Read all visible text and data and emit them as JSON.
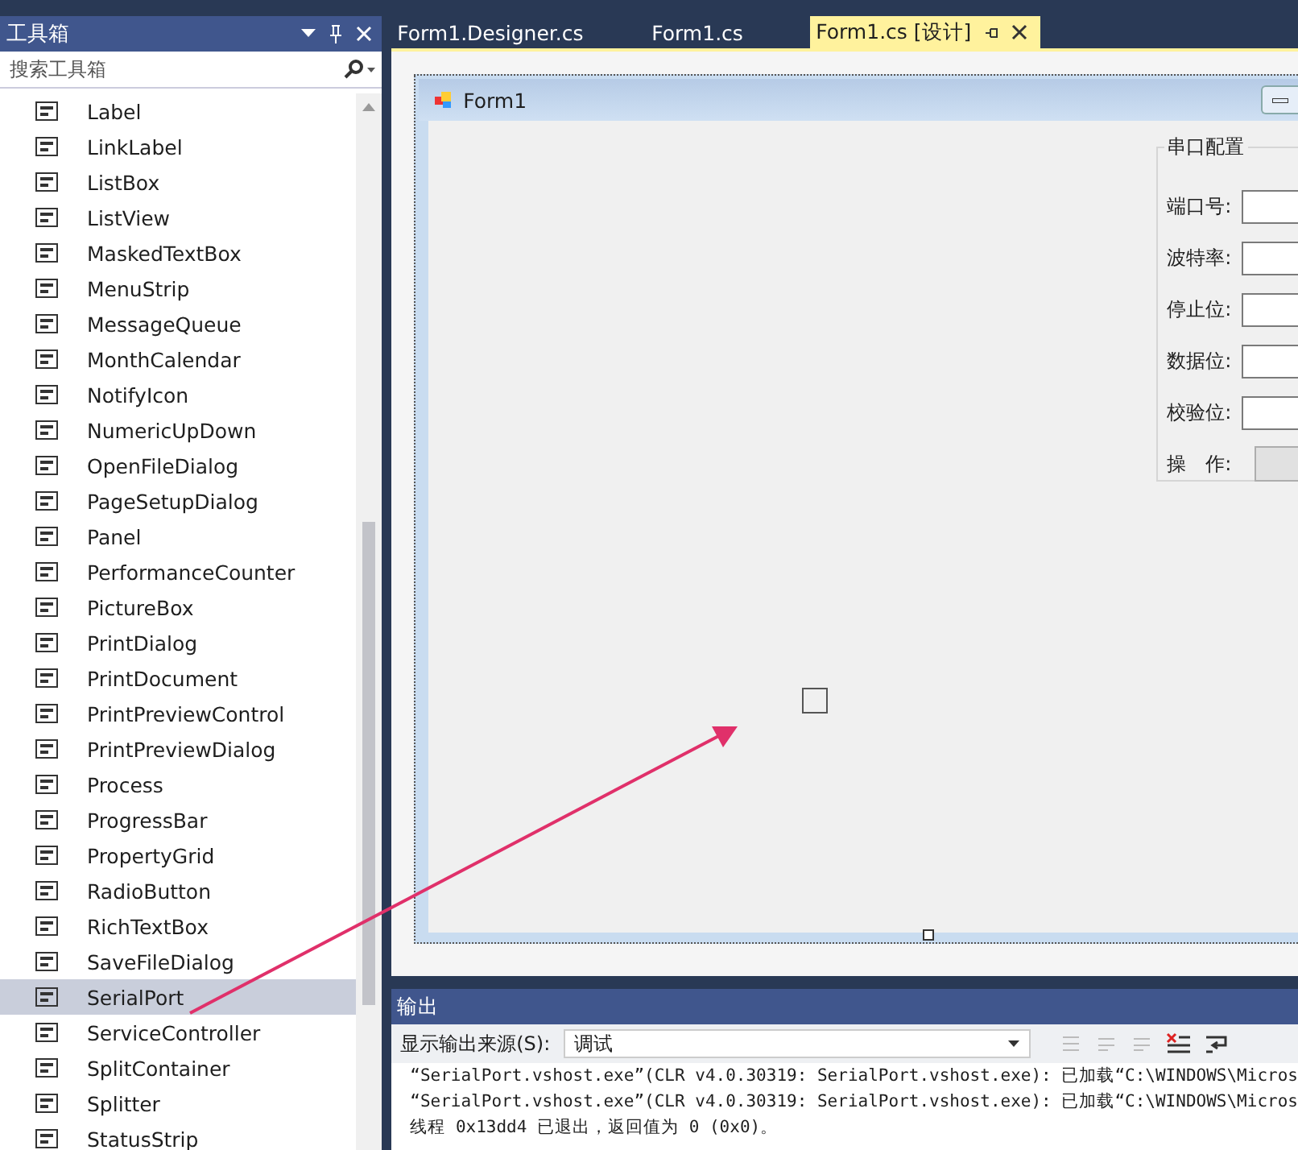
{
  "toolbox": {
    "title": "工具箱",
    "search": {
      "placeholder": "搜索工具箱"
    },
    "items": [
      {
        "label": "Label",
        "selected": false
      },
      {
        "label": "LinkLabel",
        "selected": false
      },
      {
        "label": "ListBox",
        "selected": false
      },
      {
        "label": "ListView",
        "selected": false
      },
      {
        "label": "MaskedTextBox",
        "selected": false
      },
      {
        "label": "MenuStrip",
        "selected": false
      },
      {
        "label": "MessageQueue",
        "selected": false
      },
      {
        "label": "MonthCalendar",
        "selected": false
      },
      {
        "label": "NotifyIcon",
        "selected": false
      },
      {
        "label": "NumericUpDown",
        "selected": false
      },
      {
        "label": "OpenFileDialog",
        "selected": false
      },
      {
        "label": "PageSetupDialog",
        "selected": false
      },
      {
        "label": "Panel",
        "selected": false
      },
      {
        "label": "PerformanceCounter",
        "selected": false
      },
      {
        "label": "PictureBox",
        "selected": false
      },
      {
        "label": "PrintDialog",
        "selected": false
      },
      {
        "label": "PrintDocument",
        "selected": false
      },
      {
        "label": "PrintPreviewControl",
        "selected": false
      },
      {
        "label": "PrintPreviewDialog",
        "selected": false
      },
      {
        "label": "Process",
        "selected": false
      },
      {
        "label": "ProgressBar",
        "selected": false
      },
      {
        "label": "PropertyGrid",
        "selected": false
      },
      {
        "label": "RadioButton",
        "selected": false
      },
      {
        "label": "RichTextBox",
        "selected": false
      },
      {
        "label": "SaveFileDialog",
        "selected": false
      },
      {
        "label": "SerialPort",
        "selected": true
      },
      {
        "label": "ServiceController",
        "selected": false
      },
      {
        "label": "SplitContainer",
        "selected": false
      },
      {
        "label": "Splitter",
        "selected": false
      },
      {
        "label": "StatusStrip",
        "selected": false
      }
    ]
  },
  "tabs": [
    {
      "label": "Form1.Designer.cs",
      "selected": false
    },
    {
      "label": "Form1.cs",
      "selected": false
    },
    {
      "label": "Form1.cs [设计]",
      "selected": true
    }
  ],
  "form": {
    "title": "Form1",
    "group": {
      "title": "串口配置",
      "fields": [
        {
          "label": "端口号:"
        },
        {
          "label": "波特率:"
        },
        {
          "label": "停止位:"
        },
        {
          "label": "数据位:"
        },
        {
          "label": "校验位:"
        }
      ],
      "action_label": "操　作:"
    }
  },
  "output": {
    "title": "输出",
    "source_label": "显示输出来源(S):",
    "source_value": "调试",
    "lines": [
      "“SerialPort.vshost.exe”(CLR v4.0.30319: SerialPort.vshost.exe): 已加载“C:\\WINDOWS\\Micros",
      "“SerialPort.vshost.exe”(CLR v4.0.30319: SerialPort.vshost.exe): 已加载“C:\\WINDOWS\\Micros",
      "线程 0x13dd4 已退出，返回值为 0 (0x0)。"
    ]
  }
}
